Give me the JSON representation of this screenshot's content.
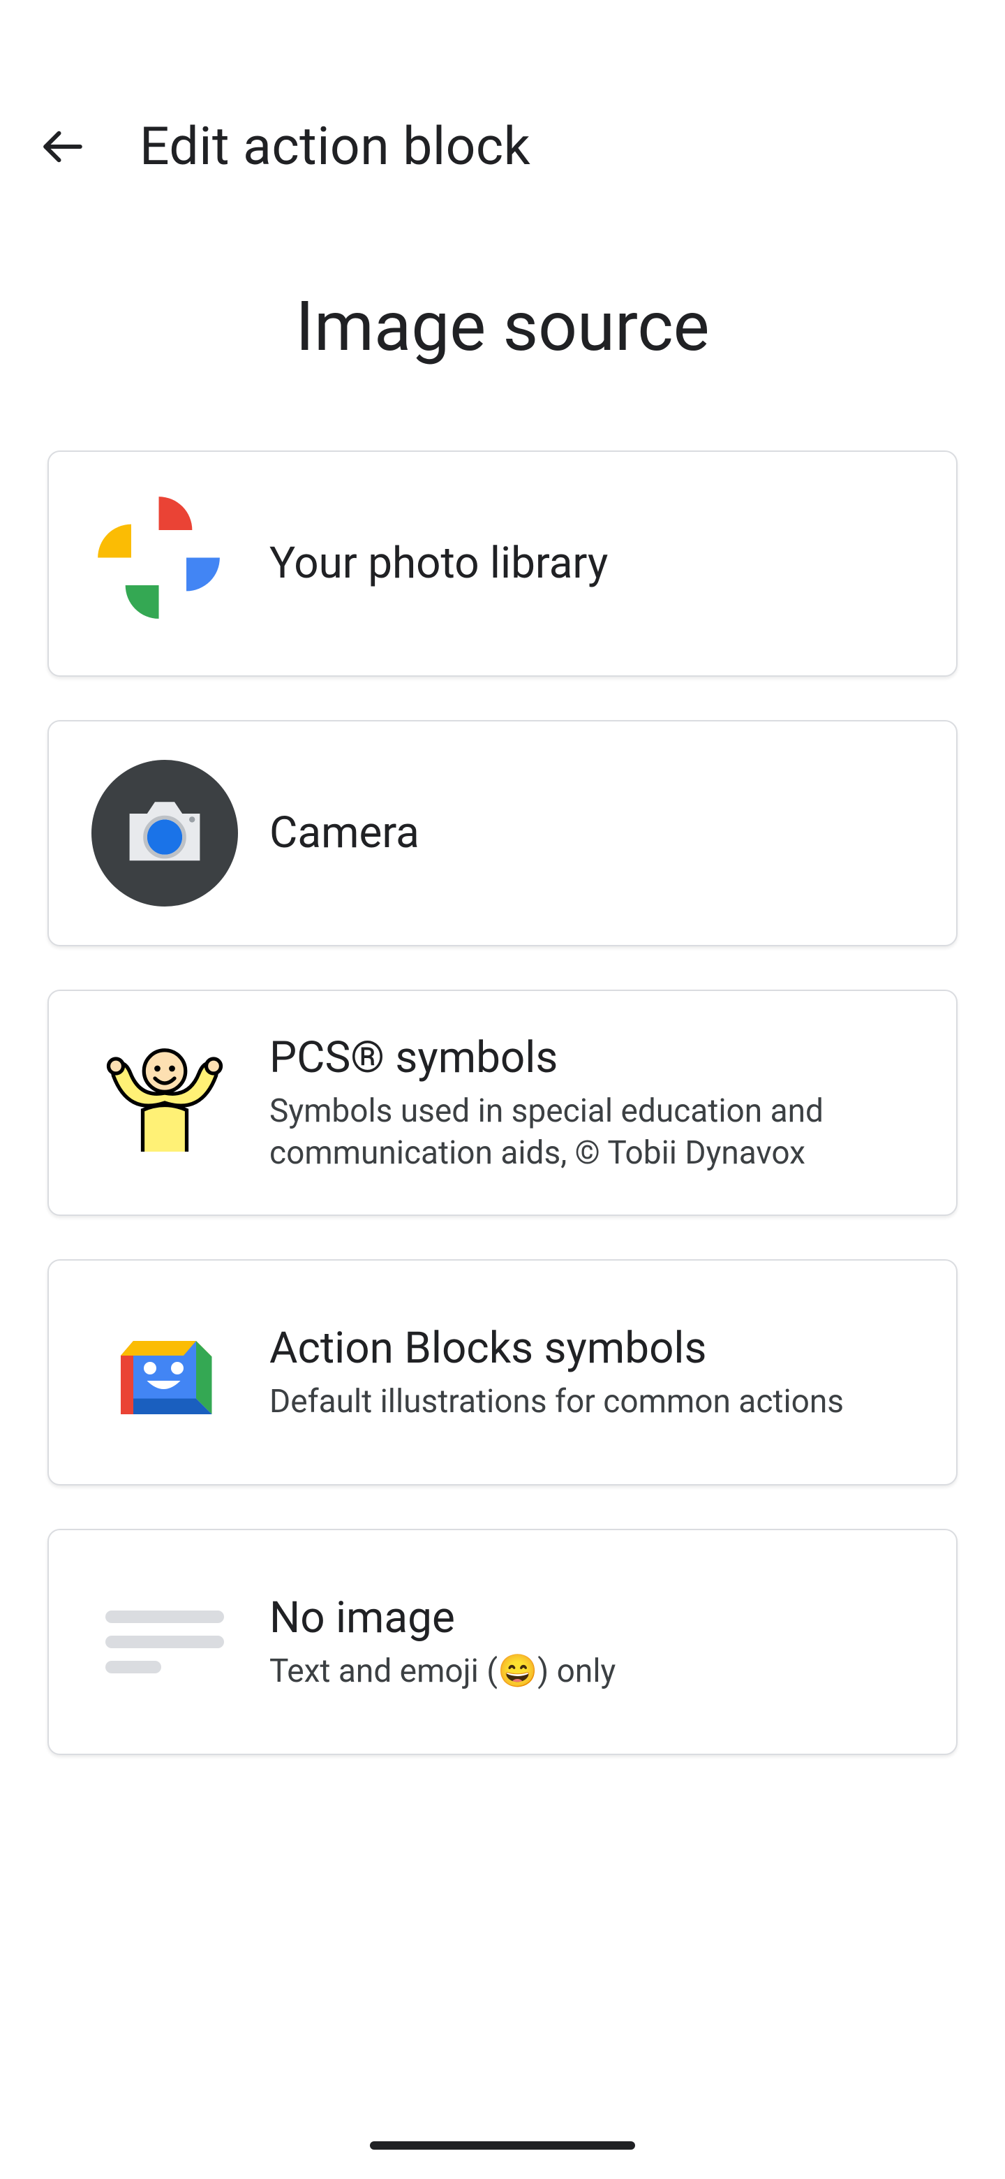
{
  "header": {
    "title": "Edit action block"
  },
  "section_title": "Image source",
  "options": {
    "photo_library": {
      "title": "Your photo library"
    },
    "camera": {
      "title": "Camera"
    },
    "pcs": {
      "title": "PCS® symbols",
      "description": "Symbols used in special education and communication aids, © Tobii Dynavox"
    },
    "action_blocks": {
      "title": "Action Blocks symbols",
      "description": "Default illustrations for common actions"
    },
    "no_image": {
      "title": "No image",
      "description": "Text and emoji (😄) only"
    }
  }
}
